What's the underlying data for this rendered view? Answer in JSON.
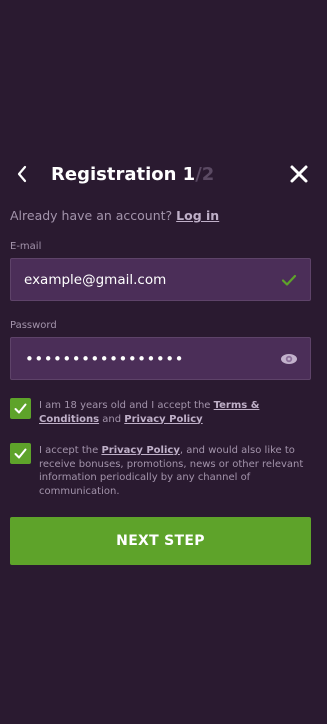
{
  "header": {
    "title": "Registration 1",
    "step_total": "/2"
  },
  "login_prompt": {
    "text": "Already have an account?",
    "link_label": "Log in"
  },
  "email": {
    "label": "E-mail",
    "value": "example@gmail.com",
    "valid_icon": "checkmark-icon"
  },
  "password": {
    "label": "Password",
    "masked_value": "•••••••••••••••••",
    "visibility_icon": "eye-icon"
  },
  "consents": [
    {
      "checked": true,
      "text_before": "I am 18 years old and I accept the",
      "link1": "Terms & Conditions",
      "text_middle": "and",
      "link2": "Privacy Policy"
    },
    {
      "checked": true,
      "text_before": "I accept the",
      "link1": "Privacy Policy",
      "text_after": ", and would also like to receive bonuses, promotions, news or other relevant information periodically by any channel of communication."
    }
  ],
  "next_button": {
    "label": "NEXT STEP"
  },
  "colors": {
    "background": "#2a1a30",
    "input_bg": "#4b2e58",
    "accent_green": "#5ea32a",
    "muted_text": "#a394ab"
  }
}
